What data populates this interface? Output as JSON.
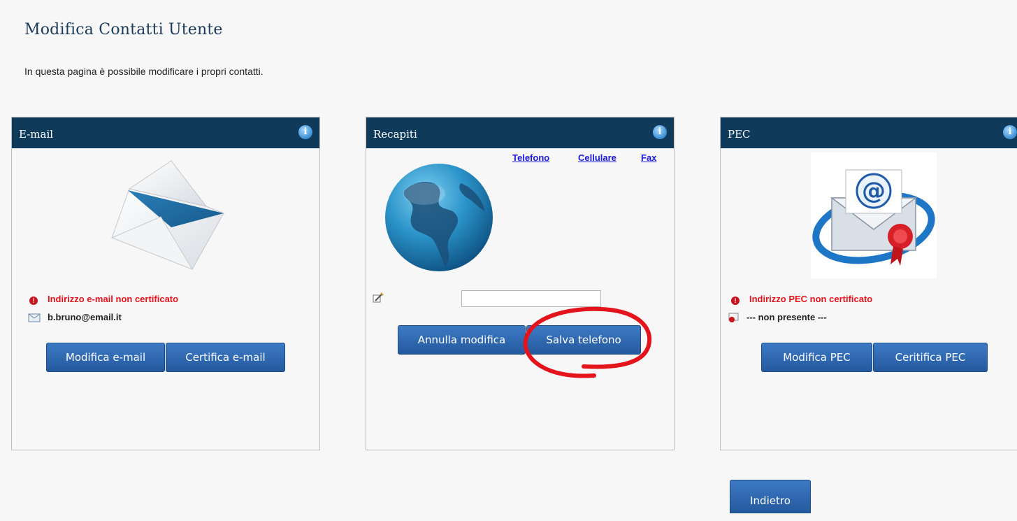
{
  "page": {
    "title": "Modifica Contatti Utente",
    "description": "In questa pagina è possibile modificare i propri contatti."
  },
  "email_panel": {
    "header": "E-mail",
    "status": "Indirizzo e-mail non certificato",
    "value": "b.bruno@email.it",
    "buttons": {
      "edit": "Modifica e-mail",
      "certify": "Certifica e-mail"
    }
  },
  "contacts_panel": {
    "header": "Recapiti",
    "tabs": [
      "Telefono",
      "Cellulare",
      "Fax"
    ],
    "phone_value": "",
    "buttons": {
      "cancel": "Annulla modifica",
      "save": "Salva telefono"
    }
  },
  "pec_panel": {
    "header": "PEC",
    "status": "Indirizzo PEC non certificato",
    "value": "--- non presente ---",
    "buttons": {
      "edit": "Modifica PEC",
      "certify": "Ceritifica PEC"
    }
  },
  "back_button": "Indietro",
  "colors": {
    "header_bg": "#0f3a5a",
    "button_bg": "#2d68b1",
    "warning": "#e2141c",
    "highlight_annotation": "#e3141c"
  },
  "icons": [
    "info-icon",
    "envelope-icon",
    "globe-icon",
    "pec-mail-icon",
    "warning-icon",
    "email-small-icon",
    "pencil-icon",
    "certificate-icon"
  ]
}
